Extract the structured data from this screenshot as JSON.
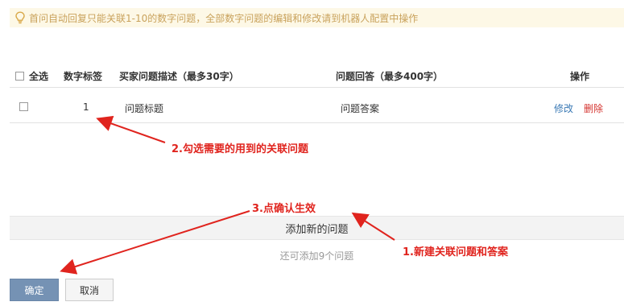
{
  "notice": {
    "text": "首问自动回复只能关联1-10的数字问题，全部数字问题的编辑和修改请到机器人配置中操作",
    "icon": "lightbulb-icon",
    "color": "#c9a25c"
  },
  "table": {
    "headers": {
      "select_all": "全选",
      "number_tag": "数字标签",
      "description": "买家问题描述（最多30字）",
      "answer": "问题回答（最多400字）",
      "actions": "操作"
    },
    "rows": [
      {
        "number": "1",
        "description": "问题标题",
        "answer": "问题答案",
        "edit": "修改",
        "delete": "删除",
        "checked": false
      }
    ]
  },
  "add_new": {
    "label": "添加新的问题"
  },
  "remaining": {
    "text": "还可添加9个问题"
  },
  "buttons": {
    "confirm": "确定",
    "cancel": "取消"
  },
  "annotations": {
    "step1": "1.新建关联问题和答案",
    "step2": "2.勾选需要的用到的关联问题",
    "step3": "3.点确认生效",
    "color": "#e0241e"
  },
  "colors": {
    "edit_link": "#3b7ab5",
    "delete_link": "#d4332f",
    "confirm_button": "#7592b4",
    "notice_bg": "#fdf8e6"
  }
}
